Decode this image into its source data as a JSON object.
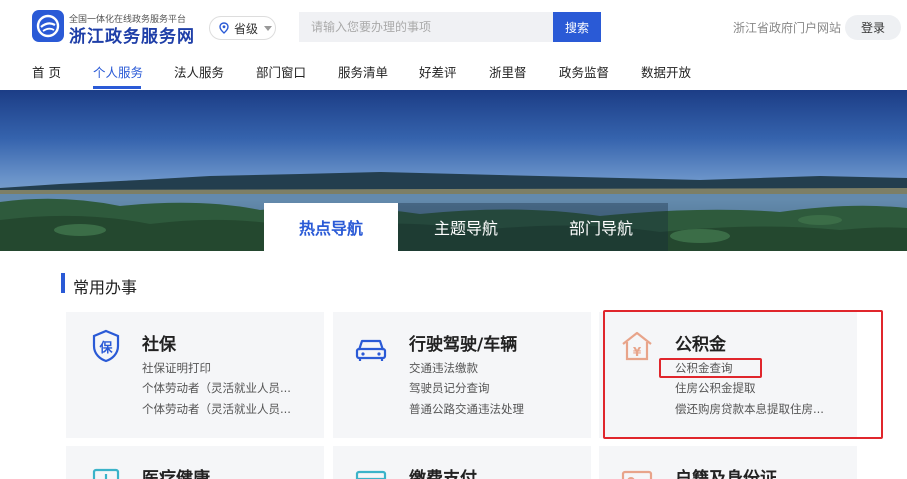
{
  "header": {
    "site_subtitle": "全国一体化在线政务服务平台",
    "site_title": "浙江政务服务网",
    "region_label": "省级",
    "search_placeholder": "请输入您要办理的事项",
    "search_button": "搜索",
    "portal_link": "浙江省政府门户网站",
    "login_button": "登录"
  },
  "nav": {
    "items": [
      {
        "label": "首 页"
      },
      {
        "label": "个人服务"
      },
      {
        "label": "法人服务"
      },
      {
        "label": "部门窗口"
      },
      {
        "label": "服务清单"
      },
      {
        "label": "好差评"
      },
      {
        "label": "浙里督"
      },
      {
        "label": "政务监督"
      },
      {
        "label": "数据开放"
      }
    ],
    "active": "个人服务"
  },
  "tabs": [
    {
      "label": "热点导航"
    },
    {
      "label": "主题导航"
    },
    {
      "label": "部门导航"
    }
  ],
  "section": {
    "title": "常用办事"
  },
  "cards": [
    {
      "title": "社保",
      "icon": "shield-bao-icon",
      "links": [
        "社保证明打印",
        "个体劳动者（灵活就业人员...",
        "个体劳动者（灵活就业人员..."
      ]
    },
    {
      "title": "行驶驾驶/车辆",
      "icon": "car-icon",
      "links": [
        "交通违法缴款",
        "驾驶员记分查询",
        "普通公路交通违法处理"
      ]
    },
    {
      "title": "公积金",
      "icon": "house-yuan-icon",
      "links": [
        "公积金查询",
        "住房公积金提取",
        "偿还购房贷款本息提取住房..."
      ]
    },
    {
      "title": "医疗健康",
      "icon": "medical-kit-icon",
      "links": []
    },
    {
      "title": "缴费支付",
      "icon": "card-payment-icon",
      "links": []
    },
    {
      "title": "户籍及身份证",
      "icon": "id-card-icon",
      "links": []
    }
  ],
  "colors": {
    "brand_blue": "#2a5ad6",
    "highlight_red": "#e0262c",
    "card_bg": "#f5f6f8"
  }
}
